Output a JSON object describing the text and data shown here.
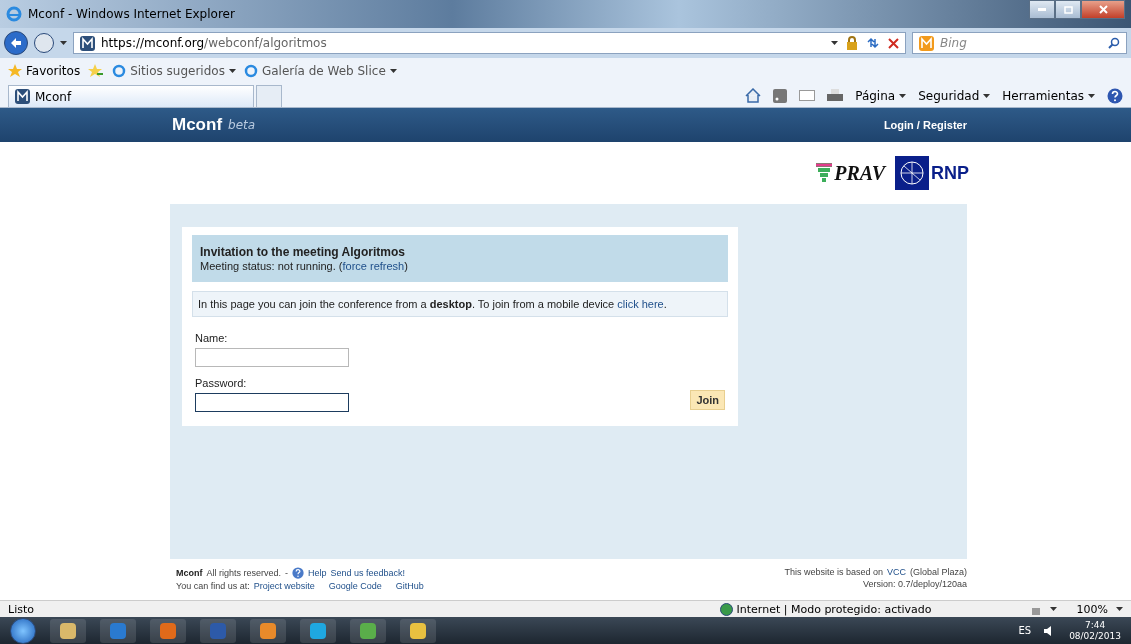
{
  "window": {
    "title": "Mconf - Windows Internet Explorer"
  },
  "address_bar": {
    "url_host": "https://mconf.org",
    "url_path": "/webconf/algoritmos",
    "search_placeholder": "Bing"
  },
  "favorites_bar": {
    "label": "Favoritos",
    "items": [
      {
        "label": "Sitios sugeridos"
      },
      {
        "label": "Galería de Web Slice"
      }
    ]
  },
  "tabs": [
    {
      "label": "Mconf",
      "selected": true
    }
  ],
  "command_bar": {
    "menus": [
      {
        "label": "Página"
      },
      {
        "label": "Seguridad"
      },
      {
        "label": "Herramientas"
      }
    ]
  },
  "site_header": {
    "brand": "Mconf",
    "tag": "beta",
    "login": "Login / Register"
  },
  "logos": {
    "prav": "PRAV",
    "rnp": "RNP"
  },
  "invitation": {
    "title": "Invitation to the meeting Algoritmos",
    "status": "Meeting status: not running. (",
    "refresh": "force refresh",
    "status_end": ")"
  },
  "notice": {
    "text": "In this page you can join the conference from a **desktop**. To join from a mobile device ",
    "link": "click here",
    "end": "."
  },
  "form": {
    "fields": [
      {
        "label": "Name:",
        "focused": false
      },
      {
        "label": "Password:",
        "focused": true
      }
    ],
    "submit": "Join"
  },
  "footer": {
    "brand": "Mconf",
    "rights": "All rights reserved.",
    "sep": "-",
    "help": "Help",
    "feedback": "Send us feedback!",
    "based_on": "This website is based on",
    "vcc": "VCC",
    "vcc_rest": "(Global Plaza)",
    "find_us": "You can find us at:",
    "links": [
      "Project website",
      "Google Code",
      "GitHub"
    ],
    "version": "Version: 0.7/deploy/120aa"
  },
  "status_bar": {
    "text": "Listo",
    "zone": "Internet | Modo protegido: activado",
    "zoom": "100%"
  },
  "taskbar": {
    "language": "ES",
    "time": "7:44",
    "date": "08/02/2013"
  }
}
